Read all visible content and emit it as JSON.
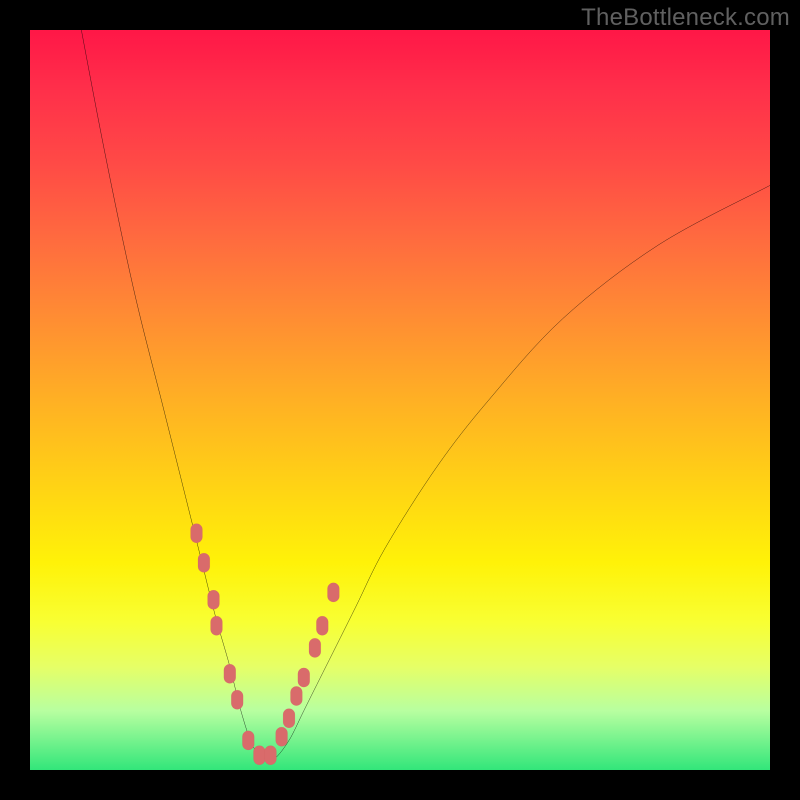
{
  "watermark": "TheBottleneck.com",
  "colors": {
    "frame": "#000000",
    "curve_stroke": "#000000",
    "marker_fill": "#d96b6b",
    "marker_stroke": "#c95b5b",
    "gradient_stops": [
      {
        "offset": 0.0,
        "color": "#ff1747"
      },
      {
        "offset": 0.08,
        "color": "#ff2f4a"
      },
      {
        "offset": 0.18,
        "color": "#ff4a46"
      },
      {
        "offset": 0.28,
        "color": "#ff6a3f"
      },
      {
        "offset": 0.38,
        "color": "#ff8a34"
      },
      {
        "offset": 0.5,
        "color": "#ffb024"
      },
      {
        "offset": 0.62,
        "color": "#ffd414"
      },
      {
        "offset": 0.72,
        "color": "#fff208"
      },
      {
        "offset": 0.8,
        "color": "#f8ff33"
      },
      {
        "offset": 0.86,
        "color": "#e6ff66"
      },
      {
        "offset": 0.92,
        "color": "#b8ffa0"
      },
      {
        "offset": 1.0,
        "color": "#32e67a"
      }
    ]
  },
  "chart_data": {
    "type": "line",
    "title": "",
    "xlabel": "",
    "ylabel": "",
    "xlim": [
      0,
      100
    ],
    "ylim": [
      0,
      100
    ],
    "note": "Axes are unlabeled in the source image; x/y are normalized 0–100 visual coordinates (0,0 = top-left of plot area). Curve is a V-shape reaching the bottom around x≈30–33.",
    "series": [
      {
        "name": "bottleneck-curve",
        "x": [
          6,
          10,
          14,
          18,
          21,
          23,
          25,
          27,
          28.5,
          30,
          31.5,
          33,
          35,
          37,
          40,
          44,
          48,
          55,
          62,
          72,
          85,
          100
        ],
        "y": [
          -5,
          16,
          35,
          51,
          63,
          71,
          79,
          86,
          92,
          96.5,
          98.5,
          98.5,
          96,
          92,
          86,
          78,
          70,
          59,
          50,
          39,
          29,
          21
        ]
      }
    ],
    "markers": {
      "name": "highlighted-points",
      "shape": "rounded-capsule",
      "x": [
        22.5,
        23.5,
        24.8,
        25.2,
        27.0,
        28.0,
        29.5,
        31.0,
        32.5,
        34.0,
        35.0,
        36.0,
        37.0,
        38.5,
        39.5,
        41.0
      ],
      "y": [
        68.0,
        72.0,
        77.0,
        80.5,
        87.0,
        90.5,
        96.0,
        98.0,
        98.0,
        95.5,
        93.0,
        90.0,
        87.5,
        83.5,
        80.5,
        76.0
      ]
    }
  }
}
